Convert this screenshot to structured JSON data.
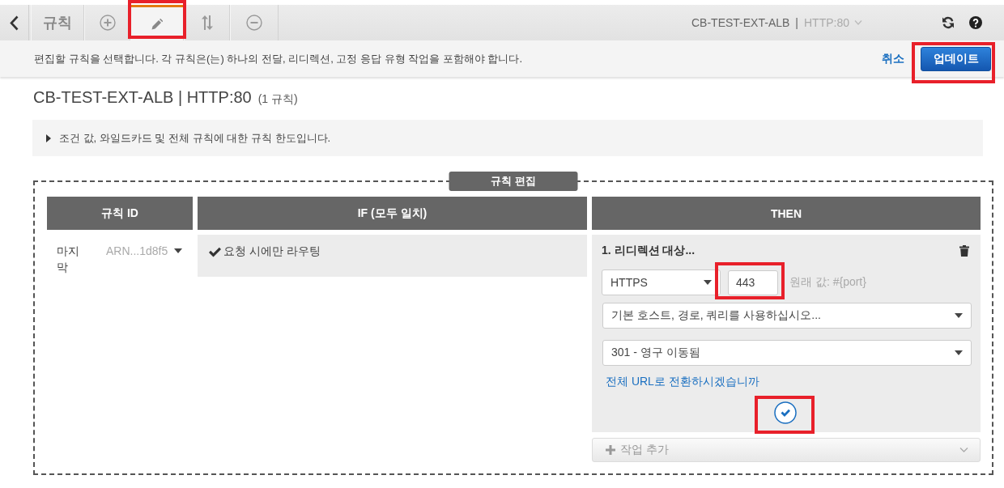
{
  "toolbar": {
    "tabs": [
      {
        "kind": "label",
        "label": "규칙",
        "selected": false,
        "highlighted": false
      },
      {
        "kind": "add",
        "selected": false,
        "highlighted": false
      },
      {
        "kind": "edit",
        "selected": true,
        "highlighted": true
      },
      {
        "kind": "reorder",
        "selected": false,
        "highlighted": false
      },
      {
        "kind": "delete",
        "selected": false,
        "highlighted": false
      }
    ],
    "context": {
      "load_balancer": "CB-TEST-EXT-ALB",
      "separator": "|",
      "listener": "HTTP:80"
    }
  },
  "instruction_bar": {
    "message": "편집할 규칙을 선택합니다. 각 규칙은(는) 하나의 전달, 리디렉션, 고정 응답 유형 작업을 포함해야 합니다.",
    "cancel": "취소",
    "update": {
      "label": "업데이트",
      "highlighted": true
    }
  },
  "heading": {
    "title": "CB-TEST-EXT-ALB | HTTP:80",
    "rule_count": "(1 규칙)"
  },
  "limits_panel": {
    "text": "조건 값, 와일드카드 및 전체 규칙에 대한 규칙 한도입니다.",
    "expanded": false
  },
  "rule_editor": {
    "legend": "규칙 편집",
    "columns": [
      "규칙 ID",
      "IF (모두 일치)",
      "THEN"
    ],
    "rules": [
      {
        "priority": "마지막",
        "rule_id": "ARN...1d8f5",
        "conditions": [
          {
            "text": "요청 시에만 라우팅"
          }
        ],
        "actions": [
          {
            "kind": "redirect",
            "title": "1. 리디렉션 대상...",
            "protocol": "HTTPS",
            "port": {
              "value": "443",
              "highlighted": true
            },
            "port_hint": "원래 값: #{port}",
            "target": "기본 호스트, 경로, 쿼리를 사용하십시오...",
            "status_code": "301 - 영구 이동됨",
            "full_url_link": "전체 URL로 전환하시겠습니까",
            "confirm": {
              "highlighted": true
            }
          }
        ],
        "add_action": "작업 추가"
      }
    ]
  }
}
